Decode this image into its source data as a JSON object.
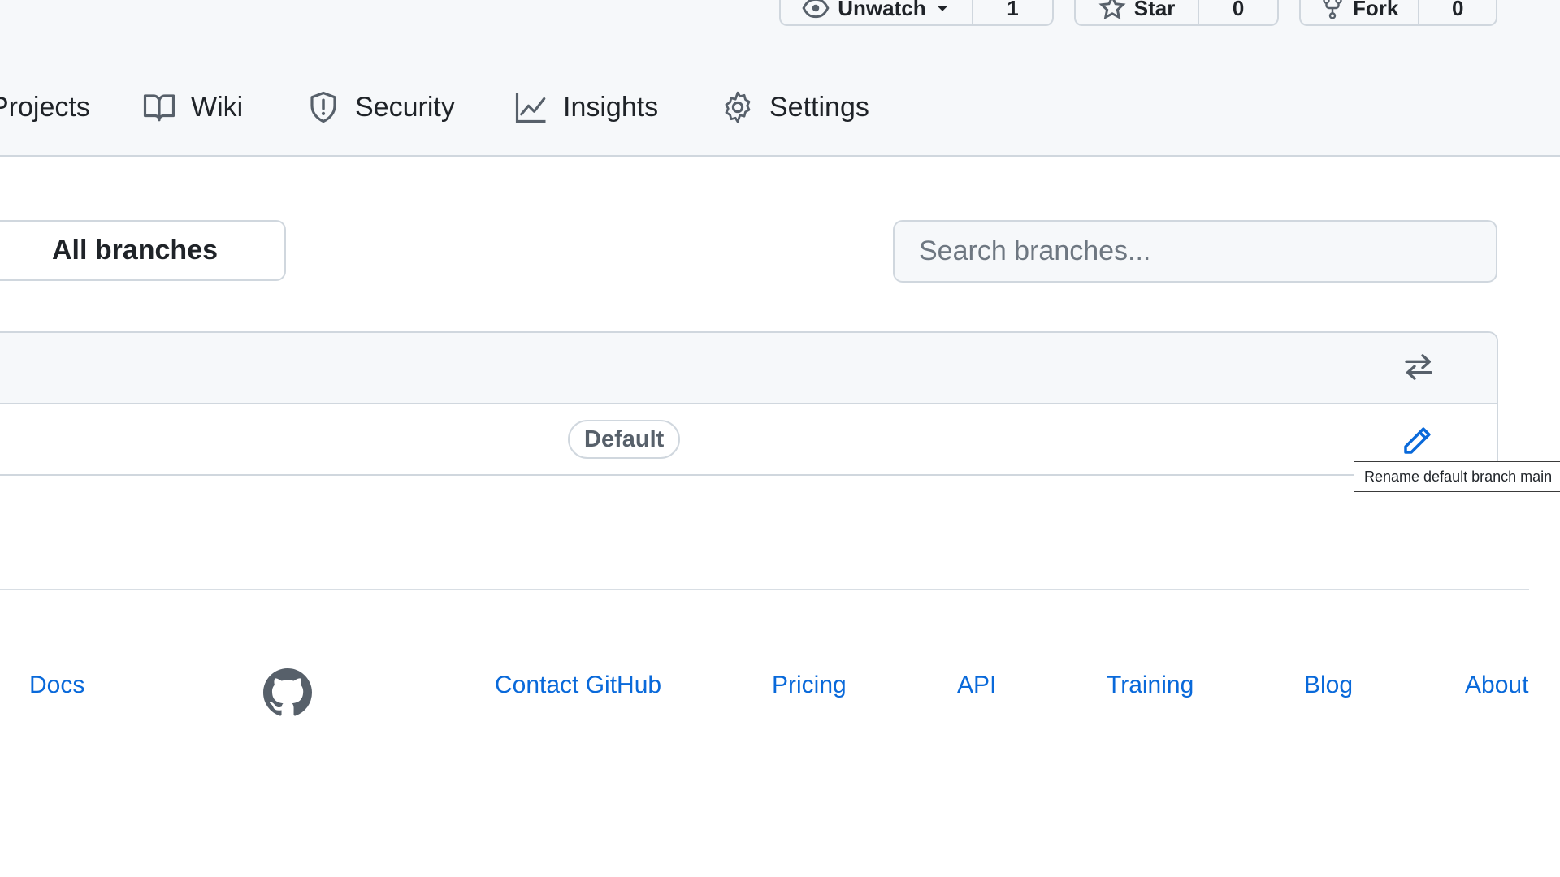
{
  "repo_actions": {
    "watch": {
      "label": "Unwatch",
      "count": "1",
      "icon": "eye-icon"
    },
    "star": {
      "label": "Star",
      "count": "0",
      "icon": "star-icon"
    },
    "fork": {
      "label": "Fork",
      "count": "0",
      "icon": "fork-icon"
    }
  },
  "nav": {
    "tabs": [
      {
        "label": "Projects",
        "icon": "table-icon"
      },
      {
        "label": "Wiki",
        "icon": "book-icon"
      },
      {
        "label": "Security",
        "icon": "shield-icon"
      },
      {
        "label": "Insights",
        "icon": "graph-icon"
      },
      {
        "label": "Settings",
        "icon": "gear-icon"
      }
    ]
  },
  "branches": {
    "filter_label": "All branches",
    "search_placeholder": "Search branches...",
    "default_badge": "Default",
    "tooltip": "Rename default branch main"
  },
  "footer": {
    "links": [
      "Docs",
      "Contact GitHub",
      "Pricing",
      "API",
      "Training",
      "Blog",
      "About"
    ],
    "logo_icon": "github-mark-icon"
  },
  "colors": {
    "link": "#0969da",
    "header_bg": "#f6f8fa",
    "border": "#d0d7de"
  }
}
